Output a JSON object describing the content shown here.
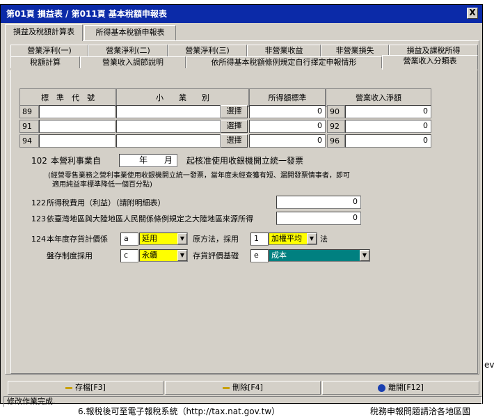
{
  "window": {
    "title": "第01頁 損益表 / 第011頁 基本稅額申報表",
    "close_label": "X"
  },
  "background": {
    "right_text": "eva",
    "bottom_left": "6.報稅後可至電子報稅系統（http://tax.nat.gov.tw）",
    "bottom_right": "稅務申報問題請洽各地區國"
  },
  "outer_tabs": [
    "損益及稅額計算表",
    "所得基本稅額申報表"
  ],
  "inner_tabs_row1": [
    "營業淨利(一)",
    "營業淨利(二)",
    "營業淨利(三)",
    "非營業收益",
    "非營業損失",
    "損益及課稅所得"
  ],
  "inner_tabs_row2": [
    "稅額計算",
    "營業收入調節說明",
    "依所得基本稅額條例規定自行擇定申報情形",
    "營業收入分類表"
  ],
  "table": {
    "headers": [
      "標　準　代　號",
      "小　　業　　別",
      "所得額標準",
      "營業收入淨額"
    ],
    "select_label": "選擇",
    "rows": [
      {
        "code": "89",
        "standard": "",
        "industry": "",
        "income": "0",
        "code2": "90",
        "revenue": "0"
      },
      {
        "code": "91",
        "standard": "",
        "industry": "",
        "income": "0",
        "code2": "92",
        "revenue": "0"
      },
      {
        "code": "94",
        "standard": "",
        "industry": "",
        "income": "0",
        "code2": "96",
        "revenue": "0"
      }
    ]
  },
  "line102": {
    "code": "102",
    "prefix": "本營利事業自",
    "year": "年",
    "month": "月",
    "suffix": "起核准使用收銀機開立統一發票",
    "note1": "(經營零售業務之營利事業使用收銀機開立統一發票，當年度未經查獲有短、漏開發票情事者，即可",
    "note2": "適用純益率標準降低一個百分點)"
  },
  "line122": {
    "code": "122",
    "label": "所得稅費用（利益）（請附明細表）",
    "value": "0"
  },
  "line123": {
    "code": "123",
    "label": "依臺灣地區與大陸地區人民關係條例規定之大陸地區來源所得",
    "value": "0"
  },
  "line124": {
    "code": "124",
    "label": "本年度存貨計價係",
    "code_a": "a",
    "method": "延用",
    "mid": "原方法，採用",
    "code_1": "1",
    "method2": "加權平均",
    "suffix": "法",
    "label2": "盤存制度採用",
    "code_c": "c",
    "system": "永續",
    "basis_label": "存貨評價基礎",
    "code_e": "e",
    "basis": "成本"
  },
  "footer": {
    "save": "存檔[F3]",
    "delete": "刪除[F4]",
    "exit": "離開[F12]"
  },
  "status": "修改作業完成.",
  "colors": {
    "title_bar": "#0b2aa8",
    "yellow": "#ffff00",
    "teal": "#008080"
  }
}
